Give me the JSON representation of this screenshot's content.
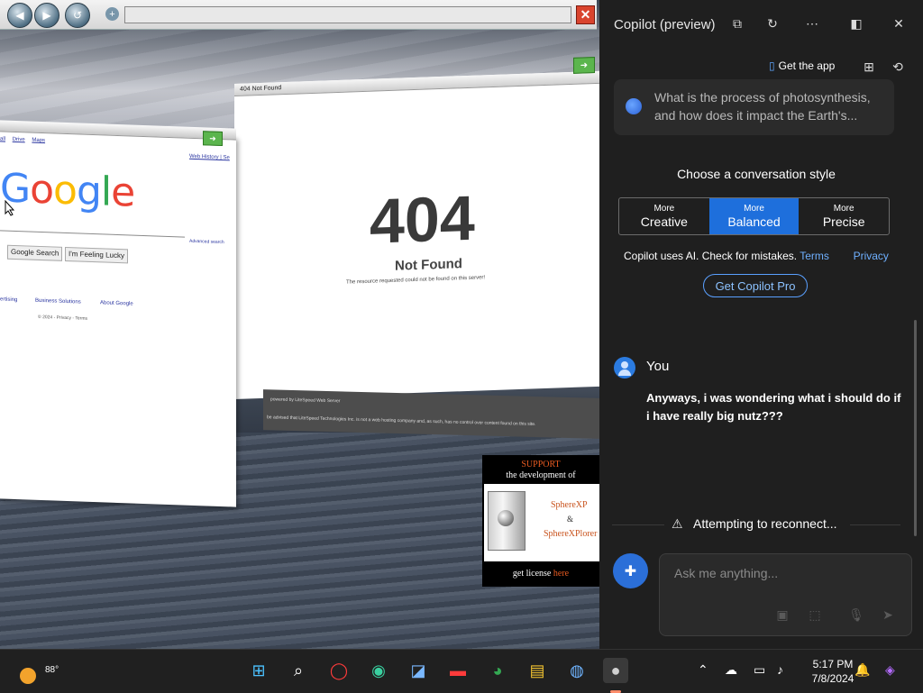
{
  "browser": {
    "back_icon": "◀",
    "forward_icon": "▶",
    "refresh_icon": "↺",
    "address_plus": "+",
    "close_icon": "✕"
  },
  "google_pane": {
    "links": [
      "all",
      "Drive",
      "Maps"
    ],
    "web_history": "Web History | Se",
    "logo": [
      "G",
      "o",
      "o",
      "g",
      "l",
      "e"
    ],
    "advanced": "Advanced search",
    "btn_search": "Google Search",
    "btn_lucky": "I'm Feeling Lucky",
    "footer_1": "ertising",
    "footer_2": "Business Solutions",
    "footer_3": "About Google",
    "copyright": "© 2024 - Privacy - Terms"
  },
  "notfound_pane": {
    "title": "404 Not Found",
    "code": "404",
    "heading": "Not Found",
    "message": "The resource requested could not be found on this server!",
    "strip_1": "powered by LiteSpeed Web Server",
    "strip_2": "be advised that LiteSpeed Technologies Inc. is not a web hosting company and, as such, has no control over content found on this site."
  },
  "ad": {
    "support": "SUPPORT",
    "dev": "the development of",
    "name1": "SphereXP",
    "amp": "&",
    "name2": "SphereXPlorer",
    "license_pre": "get license ",
    "license_here": "here"
  },
  "copilot": {
    "title": "Copilot (preview)",
    "get_app": "Get the app",
    "suggestion": "What is the process of photosynthesis, and how does it impact the Earth's...",
    "style_header": "Choose a conversation style",
    "styles": [
      {
        "top": "More",
        "main": "Creative"
      },
      {
        "top": "More",
        "main": "Balanced"
      },
      {
        "top": "More",
        "main": "Precise"
      }
    ],
    "ai_note": "Copilot uses AI. Check for mistakes.",
    "terms": "Terms",
    "privacy": "Privacy",
    "pro_button": "Get Copilot Pro",
    "you_label": "You",
    "you_message": "Anyways, i was wondering what i should do if i have really big nutz???",
    "reconnect": "Attempting to reconnect...",
    "input_placeholder": "Ask me anything..."
  },
  "taskbar": {
    "temperature": "88°",
    "time": "5:17 PM",
    "date": "7/8/2024"
  }
}
